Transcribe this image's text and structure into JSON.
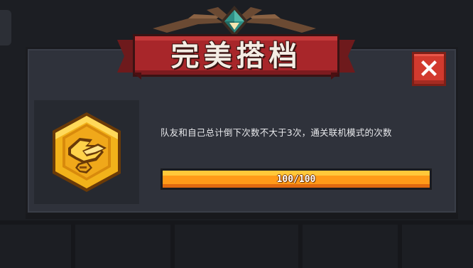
{
  "dialog": {
    "title": "完美搭档",
    "description": "队友和自己总计倒下次数不大于3次，通关联机模式的次数",
    "close_icon": "close-x-icon",
    "badge_icon": "handshake-badge-icon"
  },
  "progress": {
    "label": "100/100",
    "current": 100,
    "max": 100,
    "fraction": 1.0
  },
  "colors": {
    "banner_red": "#a8262a",
    "close_red": "#d23a2e",
    "progress_orange": "#ff9a18",
    "badge_gold": "#f2b21a",
    "panel_bg": "#2f323b"
  }
}
